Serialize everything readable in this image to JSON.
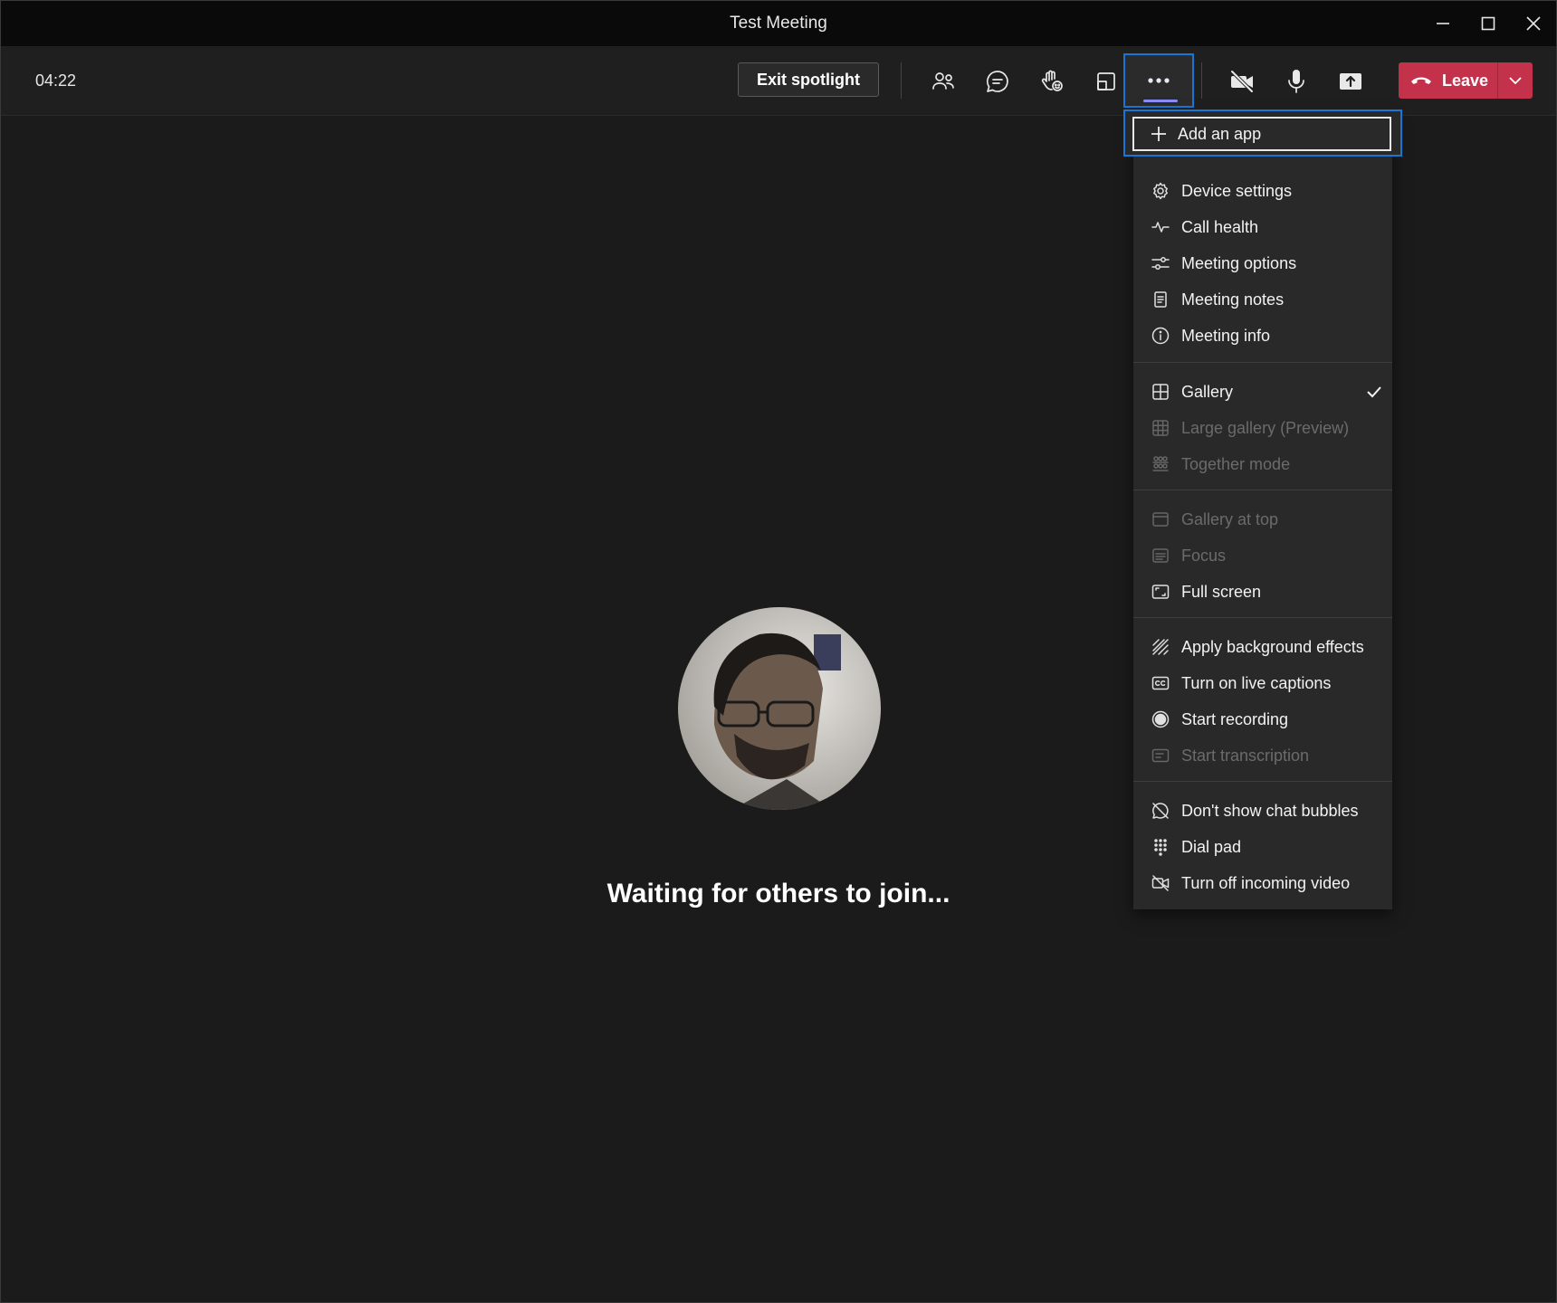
{
  "window": {
    "title": "Test Meeting"
  },
  "toolbar": {
    "timer": "04:22",
    "exit_spotlight_label": "Exit spotlight",
    "leave_label": "Leave"
  },
  "menu": {
    "add_app": "Add an app",
    "items": [
      {
        "label": "Device settings",
        "icon": "gear-icon",
        "enabled": true
      },
      {
        "label": "Call health",
        "icon": "pulse-icon",
        "enabled": true
      },
      {
        "label": "Meeting options",
        "icon": "sliders-icon",
        "enabled": true
      },
      {
        "label": "Meeting notes",
        "icon": "notes-icon",
        "enabled": true
      },
      {
        "label": "Meeting info",
        "icon": "info-icon",
        "enabled": true
      },
      {
        "label": "Gallery",
        "icon": "grid-icon",
        "enabled": true,
        "checked": true
      },
      {
        "label": "Large gallery (Preview)",
        "icon": "large-grid-icon",
        "enabled": false
      },
      {
        "label": "Together mode",
        "icon": "people-group-icon",
        "enabled": false
      },
      {
        "label": "Gallery at top",
        "icon": "gallery-top-icon",
        "enabled": false
      },
      {
        "label": "Focus",
        "icon": "focus-icon",
        "enabled": false
      },
      {
        "label": "Full screen",
        "icon": "fullscreen-icon",
        "enabled": true
      },
      {
        "label": "Apply background effects",
        "icon": "background-effects-icon",
        "enabled": true
      },
      {
        "label": "Turn on live captions",
        "icon": "cc-icon",
        "enabled": true
      },
      {
        "label": "Start recording",
        "icon": "record-icon",
        "enabled": true
      },
      {
        "label": "Start transcription",
        "icon": "transcript-icon",
        "enabled": false
      },
      {
        "label": "Don't show chat bubbles",
        "icon": "chat-off-icon",
        "enabled": true
      },
      {
        "label": "Dial pad",
        "icon": "dialpad-icon",
        "enabled": true
      },
      {
        "label": "Turn off incoming video",
        "icon": "video-off-icon",
        "enabled": true
      }
    ]
  },
  "stage": {
    "waiting_text": "Waiting for others to join..."
  },
  "colors": {
    "accent": "#1877d6",
    "leave": "#c4314b",
    "indicator": "#8b8cf5",
    "background": "#1b1b1b"
  }
}
